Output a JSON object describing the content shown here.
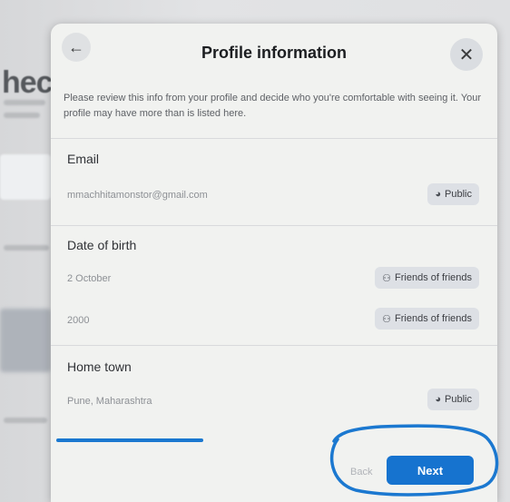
{
  "background": {
    "heading": "heci"
  },
  "modal": {
    "title": "Profile information",
    "intro": "Please review this info from your profile and decide who you're comfortable with seeing it. Your profile may have more than is listed here.",
    "sections": [
      {
        "title": "Email",
        "rows": [
          {
            "value": "mmachhitamonstor@gmail.com",
            "audience": "Public",
            "audience_icon": "globe-icon"
          }
        ]
      },
      {
        "title": "Date of birth",
        "rows": [
          {
            "value": "2 October",
            "audience": "Friends of friends",
            "audience_icon": "friends-icon"
          },
          {
            "value": "2000",
            "audience": "Friends of friends",
            "audience_icon": "friends-icon"
          }
        ]
      },
      {
        "title": "Home town",
        "rows": [
          {
            "value": "Pune, Maharashtra",
            "audience": "Public",
            "audience_icon": "globe-icon"
          }
        ]
      }
    ],
    "footer": {
      "back_label": "Back",
      "next_label": "Next",
      "progress": 0.35
    }
  },
  "colors": {
    "accent": "#1673cf",
    "annotation": "#1b78d0"
  }
}
